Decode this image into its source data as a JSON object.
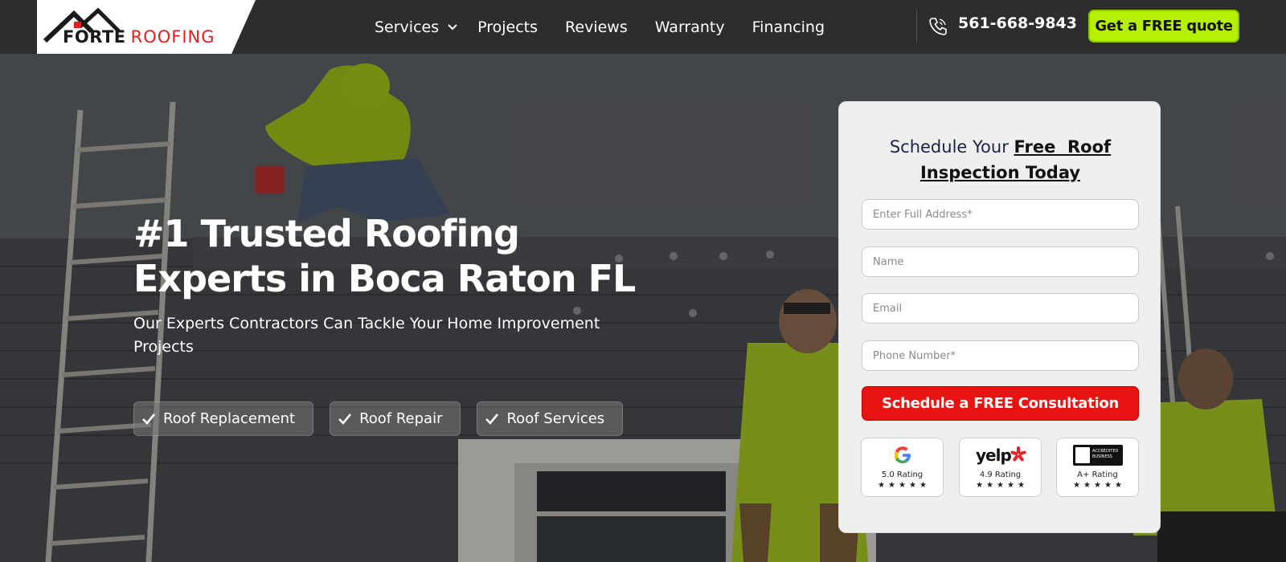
{
  "brand": {
    "name_primary": "FORTE",
    "name_secondary": "ROOFING"
  },
  "nav": {
    "items": [
      {
        "label": "Services",
        "has_dropdown": true
      },
      {
        "label": "Projects"
      },
      {
        "label": "Reviews"
      },
      {
        "label": "Warranty"
      },
      {
        "label": "Financing"
      }
    ]
  },
  "contact": {
    "phone": "561-668-9843",
    "phone_icon": "phone-icon"
  },
  "cta": {
    "quote_label": "Get a FREE quote"
  },
  "hero": {
    "title_line1": "#1 Trusted Roofing",
    "title_line2": "Experts in Boca Raton FL",
    "subtitle": "Our Experts Contractors Can Tackle Your Home Improvement Projects",
    "badges": [
      "Roof Replacement",
      "Roof Repair",
      "Roof Services"
    ]
  },
  "form": {
    "title_plain": "Schedule Your",
    "title_strong_line1": "Free  Roof",
    "title_strong_line2": "Inspection Today",
    "fields": {
      "address_placeholder": "Enter Full Address*",
      "name_placeholder": "Name",
      "email_placeholder": "Email",
      "phone_placeholder": "Phone Number*"
    },
    "submit_label": "Schedule a FREE Consultation"
  },
  "ratings": [
    {
      "source": "Google",
      "label": "5.0 Rating",
      "stars": "★★★★★",
      "logo_icon": "google-logo-icon"
    },
    {
      "source": "yelp",
      "label": "4.9 Rating",
      "stars": "★★★★★",
      "logo_icon": "yelp-logo-icon"
    },
    {
      "source": "BBB",
      "label": "A+ Rating",
      "stars": "★★★★★",
      "logo_icon": "bbb-logo-icon",
      "badge_text": "ACCREDITED BUSINESS"
    }
  ],
  "colors": {
    "header_bg": "#2d2d2d",
    "cta_green": "#b6f000",
    "submit_red": "#e81313",
    "brand_red": "#e02020"
  }
}
